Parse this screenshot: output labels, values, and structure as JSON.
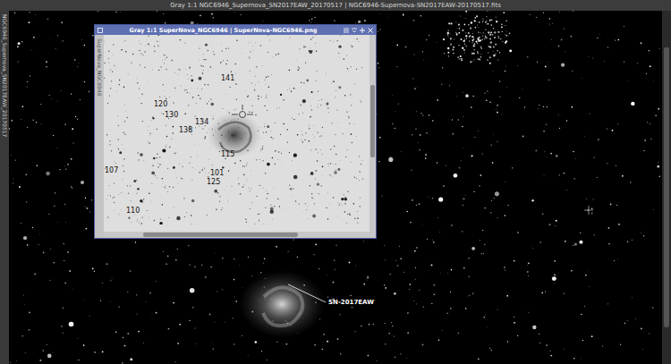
{
  "window": {
    "title": "Gray 1:1 NGC6946_Supernova_SN2017EAW_20170517 | NGC6946-Supernova-SN2017EAW-20170517.fits",
    "side_tab": "NGC6946_Supernova_SN2017EAW_20170517"
  },
  "image_annotations": [
    {
      "label": "SN-2017EAW"
    }
  ],
  "inner_window": {
    "title": "Gray 1:1 SuperNova_NGC6946 | SuperNova-NGC6946.png",
    "side_tab": "SuperNova_NGC6946",
    "labels": [
      {
        "label": "141"
      },
      {
        "label": "120"
      },
      {
        "label": "130"
      },
      {
        "label": "134"
      },
      {
        "label": "138"
      },
      {
        "label": "115"
      },
      {
        "label": "107"
      },
      {
        "label": "101"
      },
      {
        "label": "125"
      },
      {
        "label": "110"
      }
    ]
  }
}
